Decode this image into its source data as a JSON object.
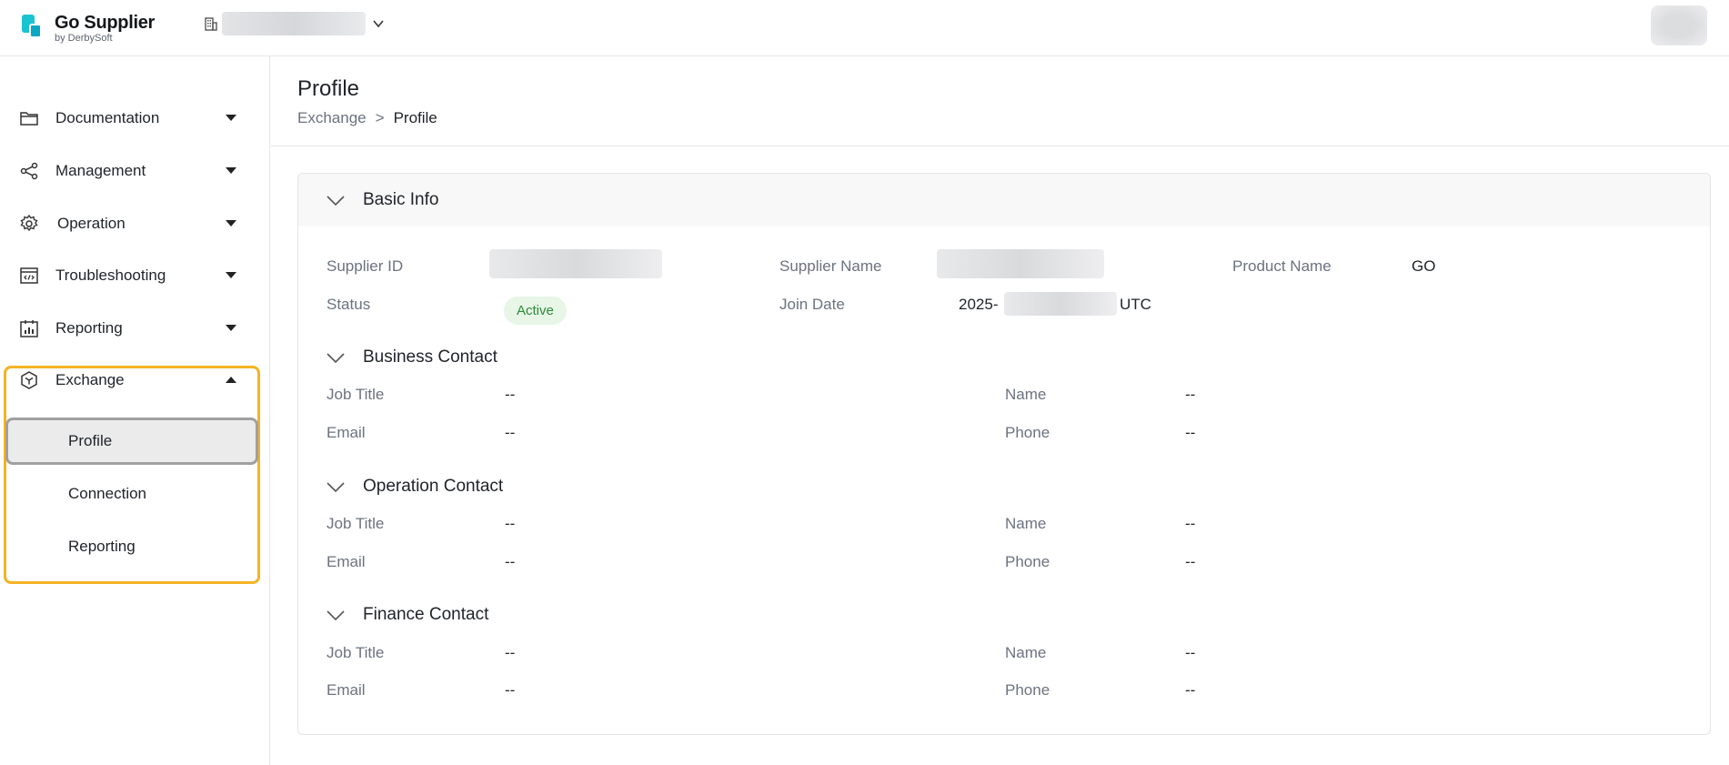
{
  "header": {
    "logo_title": "Go Supplier",
    "logo_subtitle": "by DerbySoft"
  },
  "sidebar": {
    "items": [
      {
        "label": "Documentation",
        "icon": "folder-icon"
      },
      {
        "label": "Management",
        "icon": "share-nodes-icon"
      },
      {
        "label": "Operation",
        "icon": "gear-icon"
      },
      {
        "label": "Troubleshooting",
        "icon": "code-window-icon"
      },
      {
        "label": "Reporting",
        "icon": "bar-chart-calendar-icon"
      },
      {
        "label": "Exchange",
        "icon": "cube-icon"
      }
    ],
    "exchange_sub": [
      {
        "label": "Profile",
        "active": true
      },
      {
        "label": "Connection",
        "active": false
      },
      {
        "label": "Reporting",
        "active": false
      }
    ],
    "highlight_color": "#f5b324"
  },
  "page": {
    "title": "Profile",
    "breadcrumb": {
      "parent": "Exchange",
      "separator": ">",
      "current": "Profile"
    }
  },
  "basic_info": {
    "title": "Basic Info",
    "supplier_id_label": "Supplier ID",
    "supplier_name_label": "Supplier Name",
    "product_name_label": "Product Name",
    "product_name_value": "GO",
    "status_label": "Status",
    "status_value": "Active",
    "join_date_label": "Join Date",
    "join_date_prefix": "2025-",
    "join_date_suffix": "UTC"
  },
  "contacts": [
    {
      "title": "Business Contact",
      "job_title_label": "Job Title",
      "job_title": "--",
      "name_label": "Name",
      "name": "--",
      "email_label": "Email",
      "email": "--",
      "phone_label": "Phone",
      "phone": "--"
    },
    {
      "title": "Operation Contact",
      "job_title_label": "Job Title",
      "job_title": "--",
      "name_label": "Name",
      "name": "--",
      "email_label": "Email",
      "email": "--",
      "phone_label": "Phone",
      "phone": "--"
    },
    {
      "title": "Finance Contact",
      "job_title_label": "Job Title",
      "job_title": "--",
      "name_label": "Name",
      "name": "--",
      "email_label": "Email",
      "email": "--",
      "phone_label": "Phone",
      "phone": "--"
    }
  ]
}
